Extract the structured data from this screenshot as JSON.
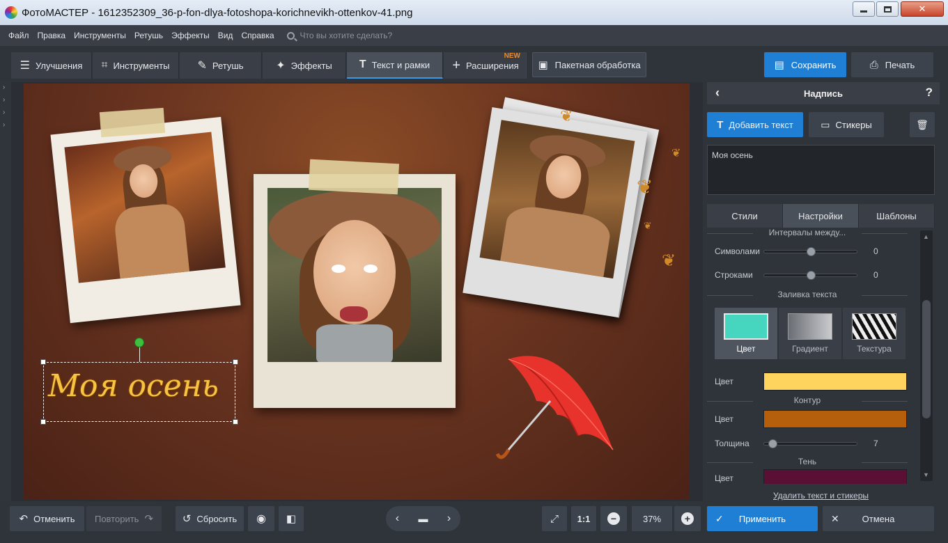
{
  "window": {
    "title": "ФотоМАСТЕР - 1612352309_36-p-fon-dlya-fotoshopa-korichnevikh-ottenkov-41.png"
  },
  "menu": {
    "items": [
      "Файл",
      "Правка",
      "Инструменты",
      "Ретушь",
      "Эффекты",
      "Вид",
      "Справка"
    ],
    "search_placeholder": "Что вы хотите сделать?"
  },
  "toolbar": {
    "tabs": [
      {
        "label": "Улучшения",
        "icon": "sliders-icon"
      },
      {
        "label": "Инструменты",
        "icon": "crop-icon"
      },
      {
        "label": "Ретушь",
        "icon": "brush-icon"
      },
      {
        "label": "Эффекты",
        "icon": "magic-wand-icon"
      },
      {
        "label": "Текст и рамки",
        "icon": "text-icon"
      },
      {
        "label": "Расширения",
        "icon": "plus-icon",
        "badge": "NEW"
      }
    ],
    "batch_label": "Пакетная обработка",
    "save_label": "Сохранить",
    "print_label": "Печать"
  },
  "canvas": {
    "caption_text": "Моя осень"
  },
  "panel": {
    "title": "Надпись",
    "add_text_label": "Добавить текст",
    "stickers_label": "Стикеры",
    "text_value": "Моя осень",
    "tabs": [
      "Стили",
      "Настройки",
      "Шаблоны"
    ],
    "intervals_title": "Интервалы между...",
    "chars_label": "Символами",
    "chars_value": "0",
    "lines_label": "Строками",
    "lines_value": "0",
    "fill_title": "Заливка текста",
    "fill_options": [
      "Цвет",
      "Градиент",
      "Текстура"
    ],
    "fill_color_label": "Цвет",
    "fill_color": "#FFD45E",
    "outline_title": "Контур",
    "outline_color_label": "Цвет",
    "outline_color": "#B55E0C",
    "thickness_label": "Толщина",
    "thickness_value": "7",
    "shadow_title": "Тень",
    "shadow_color_label": "Цвет",
    "shadow_color": "#5A0F35",
    "delete_link": "Удалить текст и стикеры"
  },
  "bottom": {
    "undo_label": "Отменить",
    "redo_label": "Повторить",
    "reset_label": "Сбросить",
    "one_to_one": "1:1",
    "zoom_value": "37%",
    "apply_label": "Применить",
    "cancel_label": "Отмена"
  },
  "colors": {
    "accent": "#1F7FD4",
    "new_badge": "#F08A24"
  }
}
